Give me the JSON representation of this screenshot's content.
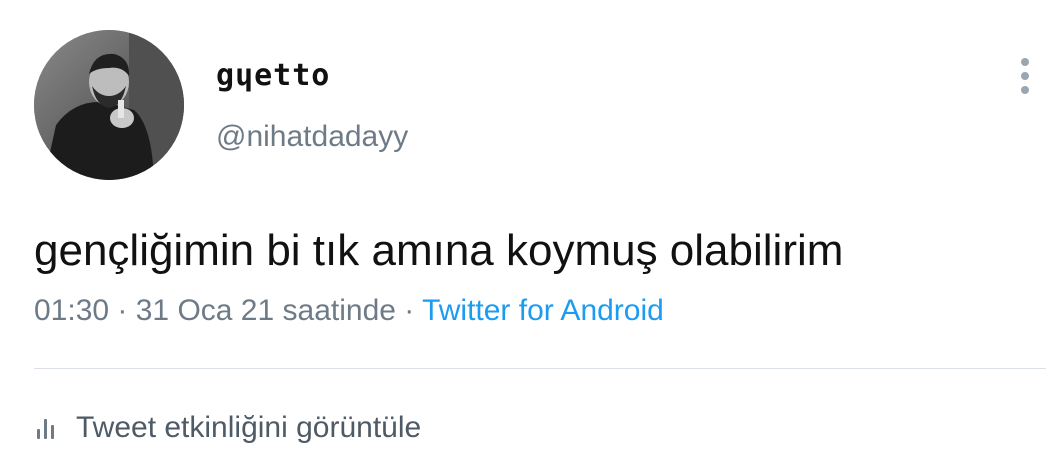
{
  "author": {
    "display_name": "gɥetto",
    "username": "@nihatdadayy"
  },
  "tweet": {
    "text": "gençliğimin bi tık amına koymuş olabilirim",
    "time": "01:30",
    "separator1": " · ",
    "date": "31 Oca 21 saatinde",
    "separator2": " · ",
    "source": "Twitter for Android"
  },
  "actions": {
    "analytics_label": "Tweet etkinliğini görüntüle"
  },
  "icons": {
    "more": "more-vertical-icon",
    "analytics": "bar-chart-icon"
  },
  "colors": {
    "text": "#111111",
    "secondary": "#6e7b87",
    "link": "#1d9bf0",
    "divider": "#dbe1e6"
  }
}
